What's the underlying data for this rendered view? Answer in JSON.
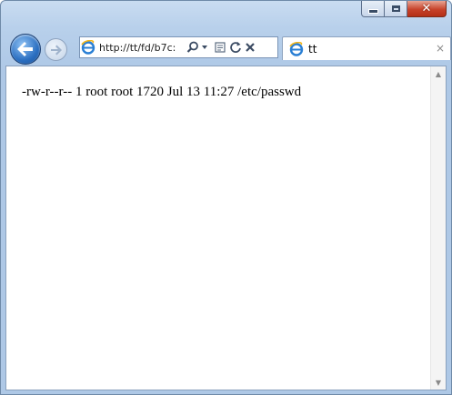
{
  "window": {
    "caption_buttons": {
      "minimize": "minimize-icon",
      "maximize": "maximize-icon",
      "close": "close-icon"
    }
  },
  "navbar": {
    "back_icon": "back-arrow-icon",
    "forward_icon": "forward-arrow-icon",
    "address": {
      "url": "http://tt/fd/b7c:"
    },
    "tab": {
      "title": "tt",
      "close_glyph": "×"
    }
  },
  "content": {
    "text": "-rw-r--r-- 1 root root 1720 Jul 13 11:27 /etc/passwd"
  },
  "colors": {
    "accent": "#2b6fc1",
    "close_red": "#c7422a",
    "frame": "#b8d0eb"
  }
}
